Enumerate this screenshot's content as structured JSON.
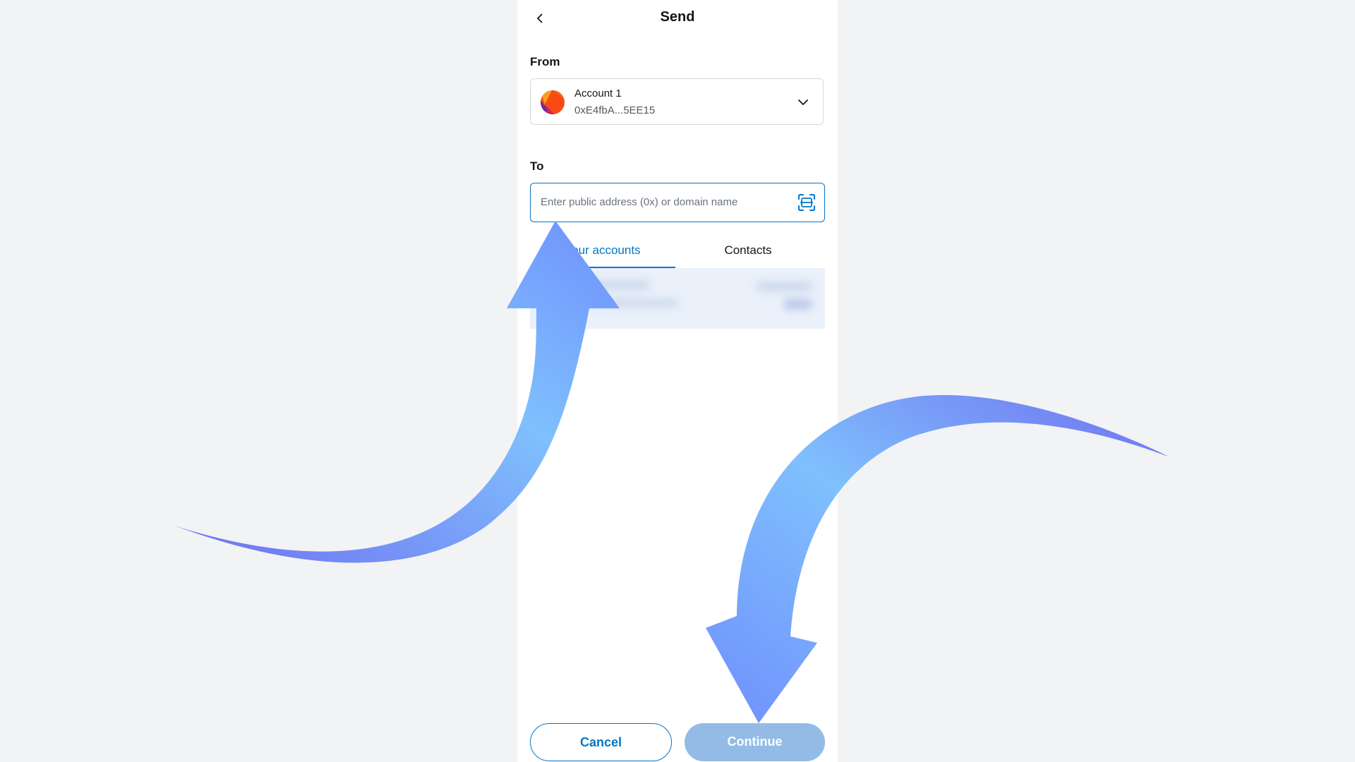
{
  "header": {
    "title": "Send",
    "back_icon": "chevron-left-icon"
  },
  "from": {
    "label": "From",
    "account_name": "Account 1",
    "account_address": "0xE4fbA...5EE15",
    "dropdown_icon": "chevron-down-icon"
  },
  "to": {
    "label": "To",
    "placeholder": "Enter public address (0x) or domain name",
    "value": "",
    "scan_icon": "qr-scan-icon"
  },
  "tabs": [
    {
      "label": "Your accounts",
      "active": true
    },
    {
      "label": "Contacts",
      "active": false
    }
  ],
  "footer": {
    "cancel_label": "Cancel",
    "continue_label": "Continue",
    "continue_disabled": true
  },
  "colors": {
    "accent": "#0376c9",
    "disabled_button": "#94bbe6",
    "background": "#f2f3f5",
    "arrow_gradient_start": "#6f6ff0",
    "arrow_gradient_end": "#7fc0fd"
  }
}
